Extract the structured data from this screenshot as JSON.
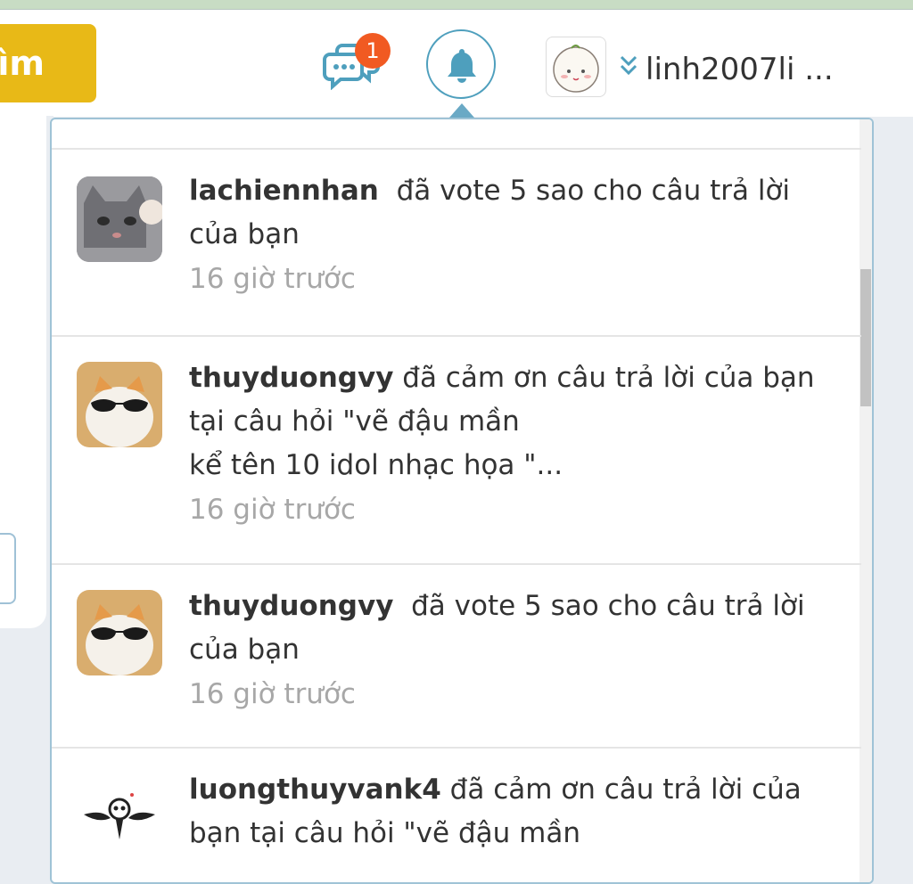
{
  "header": {
    "search_label": "ìm",
    "messages_badge": "1",
    "username": "linh2007li ..."
  },
  "notifications": [
    {
      "user": "lachiennhan",
      "message": "đã vote 5 sao cho câu trả lời của bạn",
      "time": "16 giờ trước",
      "avatar_icon": "gray-cat-avatar"
    },
    {
      "user": "thuyduongvy",
      "message": "đã cảm ơn câu trả lời của bạn tại câu hỏi \"vẽ đậu mần",
      "message_line2": "kể tên 10 idol nhạc họa \"...",
      "time": "16 giờ trước",
      "avatar_icon": "cat-sunglasses-avatar"
    },
    {
      "user": "thuyduongvy",
      "message": "đã vote 5 sao cho câu trả lời của bạn",
      "time": "16 giờ trước",
      "avatar_icon": "cat-sunglasses-avatar"
    },
    {
      "user": "luongthuyvank4",
      "message": "đã cảm ơn câu trả lời của bạn tại câu hỏi \"vẽ đậu mần",
      "avatar_icon": "skull-wings-avatar"
    }
  ],
  "colors": {
    "search_button": "#e8b917",
    "badge": "#f15a22",
    "accent": "#4e9fbd"
  }
}
